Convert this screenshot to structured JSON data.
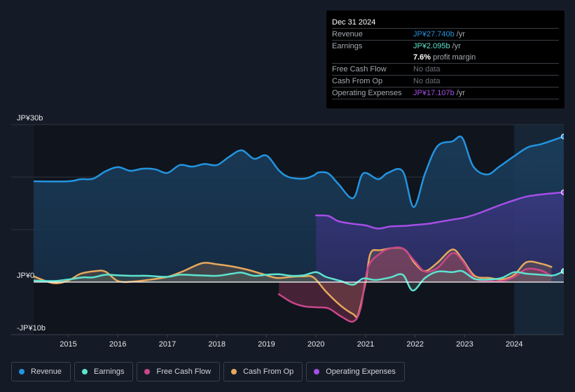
{
  "tooltip": {
    "date": "Dec 31 2024",
    "rows": [
      {
        "label": "Revenue",
        "value": "JP¥27.740b",
        "unit": " /yr",
        "color": "#2394df"
      },
      {
        "label": "Earnings",
        "value": "JP¥2.095b",
        "unit": " /yr",
        "color": "#5de3cf"
      },
      {
        "label": "",
        "value": "7.6%",
        "unit": " profit margin",
        "color": "#ffffff"
      },
      {
        "label": "Free Cash Flow",
        "value": "No data",
        "unit": "",
        "color": "#6b7078"
      },
      {
        "label": "Cash From Op",
        "value": "No data",
        "unit": "",
        "color": "#6b7078"
      },
      {
        "label": "Operating Expenses",
        "value": "JP¥17.107b",
        "unit": " /yr",
        "color": "#a64ee6"
      }
    ]
  },
  "legend": [
    {
      "label": "Revenue",
      "color": "#2394df"
    },
    {
      "label": "Earnings",
      "color": "#5de3cf"
    },
    {
      "label": "Free Cash Flow",
      "color": "#c8478a"
    },
    {
      "label": "Cash From Op",
      "color": "#e6a85d"
    },
    {
      "label": "Operating Expenses",
      "color": "#a64ee6"
    }
  ],
  "chart_data": {
    "type": "area",
    "title": "",
    "xlabel": "",
    "ylabel": "",
    "currency_unit": "JP¥ billions",
    "xlim": [
      2014.3,
      2025.0
    ],
    "ylim": [
      -10,
      30
    ],
    "y_ticks": [
      {
        "value": 30,
        "label": "JP¥30b"
      },
      {
        "value": 0,
        "label": "JP¥0"
      },
      {
        "value": -10,
        "label": "-JP¥10b"
      }
    ],
    "x_ticks": [
      {
        "value": 2015,
        "label": "2015"
      },
      {
        "value": 2016,
        "label": "2016"
      },
      {
        "value": 2017,
        "label": "2017"
      },
      {
        "value": 2018,
        "label": "2018"
      },
      {
        "value": 2019,
        "label": "2019"
      },
      {
        "value": 2020,
        "label": "2020"
      },
      {
        "value": 2021,
        "label": "2021"
      },
      {
        "value": 2022,
        "label": "2022"
      },
      {
        "value": 2023,
        "label": "2023"
      },
      {
        "value": 2024,
        "label": "2024"
      }
    ],
    "grid": true,
    "highlight_from": 2024.0,
    "legend_position": "bottom-left",
    "series": [
      {
        "name": "Revenue",
        "color": "#2394df",
        "points": [
          [
            2014.3,
            19.2
          ],
          [
            2015.0,
            19.2
          ],
          [
            2015.25,
            19.6
          ],
          [
            2015.5,
            19.7
          ],
          [
            2015.75,
            21.1
          ],
          [
            2016.0,
            21.9
          ],
          [
            2016.25,
            21.2
          ],
          [
            2016.5,
            21.6
          ],
          [
            2016.75,
            21.5
          ],
          [
            2017.0,
            20.8
          ],
          [
            2017.25,
            22.3
          ],
          [
            2017.5,
            22.0
          ],
          [
            2017.75,
            22.5
          ],
          [
            2018.0,
            22.3
          ],
          [
            2018.25,
            23.9
          ],
          [
            2018.5,
            25.1
          ],
          [
            2018.75,
            23.5
          ],
          [
            2019.0,
            24.1
          ],
          [
            2019.25,
            21.3
          ],
          [
            2019.45,
            20.0
          ],
          [
            2019.75,
            19.7
          ],
          [
            2019.95,
            20.3
          ],
          [
            2020.05,
            20.9
          ],
          [
            2020.25,
            20.7
          ],
          [
            2020.45,
            18.7
          ],
          [
            2020.75,
            16.0
          ],
          [
            2020.95,
            20.7
          ],
          [
            2021.25,
            19.6
          ],
          [
            2021.45,
            20.8
          ],
          [
            2021.75,
            21.1
          ],
          [
            2021.97,
            14.3
          ],
          [
            2022.2,
            20.7
          ],
          [
            2022.45,
            25.9
          ],
          [
            2022.75,
            26.8
          ],
          [
            2022.95,
            27.5
          ],
          [
            2023.17,
            22.1
          ],
          [
            2023.45,
            20.5
          ],
          [
            2023.7,
            22.0
          ],
          [
            2024.0,
            24.0
          ],
          [
            2024.28,
            25.7
          ],
          [
            2024.55,
            26.3
          ],
          [
            2025.0,
            27.74
          ]
        ]
      },
      {
        "name": "Earnings",
        "color": "#5de3cf",
        "points": [
          [
            2014.3,
            0.3
          ],
          [
            2014.7,
            0.2
          ],
          [
            2015.0,
            0.5
          ],
          [
            2015.3,
            0.9
          ],
          [
            2015.5,
            0.9
          ],
          [
            2015.75,
            1.4
          ],
          [
            2016.0,
            1.3
          ],
          [
            2016.3,
            1.2
          ],
          [
            2016.6,
            1.2
          ],
          [
            2017.0,
            1.0
          ],
          [
            2017.25,
            1.4
          ],
          [
            2017.6,
            1.3
          ],
          [
            2018.0,
            1.2
          ],
          [
            2018.3,
            1.6
          ],
          [
            2018.5,
            1.8
          ],
          [
            2018.75,
            1.2
          ],
          [
            2019.0,
            1.4
          ],
          [
            2019.25,
            1.5
          ],
          [
            2019.5,
            1.2
          ],
          [
            2019.75,
            1.3
          ],
          [
            2020.0,
            1.9
          ],
          [
            2020.2,
            1.0
          ],
          [
            2020.5,
            0.2
          ],
          [
            2020.75,
            -0.5
          ],
          [
            2020.95,
            0.7
          ],
          [
            2021.2,
            0.4
          ],
          [
            2021.5,
            0.9
          ],
          [
            2021.75,
            1.4
          ],
          [
            2021.95,
            -1.6
          ],
          [
            2022.2,
            0.8
          ],
          [
            2022.45,
            2.0
          ],
          [
            2022.75,
            1.9
          ],
          [
            2022.95,
            2.1
          ],
          [
            2023.2,
            0.6
          ],
          [
            2023.5,
            0.5
          ],
          [
            2023.75,
            0.8
          ],
          [
            2024.0,
            1.9
          ],
          [
            2024.25,
            1.6
          ],
          [
            2024.55,
            1.4
          ],
          [
            2024.8,
            1.3
          ],
          [
            2025.0,
            2.095
          ]
        ]
      },
      {
        "name": "Free Cash Flow",
        "color": "#c8478a",
        "points": [
          [
            2019.25,
            -2.3
          ],
          [
            2019.5,
            -3.8
          ],
          [
            2019.75,
            -4.6
          ],
          [
            2020.0,
            -4.8
          ],
          [
            2020.25,
            -5.0
          ],
          [
            2020.5,
            -6.5
          ],
          [
            2020.75,
            -7.5
          ],
          [
            2020.9,
            -5.0
          ],
          [
            2021.05,
            2.8
          ],
          [
            2021.3,
            5.5
          ],
          [
            2021.5,
            6.4
          ],
          [
            2021.75,
            6.4
          ],
          [
            2022.0,
            3.9
          ],
          [
            2022.2,
            2.0
          ],
          [
            2022.45,
            2.7
          ],
          [
            2022.75,
            5.5
          ],
          [
            2022.95,
            4.1
          ],
          [
            2023.2,
            0.7
          ],
          [
            2023.5,
            0.2
          ],
          [
            2023.75,
            0.2
          ],
          [
            2024.0,
            1.0
          ],
          [
            2024.25,
            2.5
          ],
          [
            2024.55,
            2.2
          ],
          [
            2024.75,
            1.1
          ]
        ]
      },
      {
        "name": "Cash From Op",
        "color": "#e6a85d",
        "points": [
          [
            2014.3,
            1.1
          ],
          [
            2014.7,
            -0.2
          ],
          [
            2015.0,
            0.3
          ],
          [
            2015.25,
            1.6
          ],
          [
            2015.55,
            2.1
          ],
          [
            2015.75,
            2.0
          ],
          [
            2016.0,
            0.2
          ],
          [
            2016.3,
            0.1
          ],
          [
            2016.6,
            0.4
          ],
          [
            2017.0,
            1.0
          ],
          [
            2017.3,
            2.0
          ],
          [
            2017.7,
            3.6
          ],
          [
            2018.0,
            3.4
          ],
          [
            2018.3,
            3.0
          ],
          [
            2018.6,
            2.4
          ],
          [
            2018.9,
            1.6
          ],
          [
            2019.2,
            0.8
          ],
          [
            2019.5,
            1.0
          ],
          [
            2019.75,
            1.1
          ],
          [
            2019.95,
            0.9
          ],
          [
            2020.2,
            -1.8
          ],
          [
            2020.5,
            -4.5
          ],
          [
            2020.75,
            -6.1
          ],
          [
            2020.85,
            -6.2
          ],
          [
            2021.0,
            0.0
          ],
          [
            2021.1,
            5.5
          ],
          [
            2021.3,
            6.1
          ],
          [
            2021.75,
            6.4
          ],
          [
            2022.0,
            3.5
          ],
          [
            2022.2,
            2.1
          ],
          [
            2022.45,
            3.7
          ],
          [
            2022.75,
            6.2
          ],
          [
            2022.95,
            4.4
          ],
          [
            2023.2,
            1.2
          ],
          [
            2023.5,
            0.8
          ],
          [
            2023.75,
            0.5
          ],
          [
            2024.0,
            1.4
          ],
          [
            2024.25,
            3.8
          ],
          [
            2024.55,
            3.5
          ],
          [
            2024.75,
            2.9
          ]
        ]
      },
      {
        "name": "Operating Expenses",
        "color": "#a64ee6",
        "points": [
          [
            2020.0,
            12.7
          ],
          [
            2020.25,
            12.6
          ],
          [
            2020.45,
            11.6
          ],
          [
            2020.75,
            11.1
          ],
          [
            2021.0,
            10.8
          ],
          [
            2021.25,
            10.2
          ],
          [
            2021.5,
            10.6
          ],
          [
            2021.75,
            10.7
          ],
          [
            2022.0,
            10.9
          ],
          [
            2022.25,
            11.1
          ],
          [
            2022.5,
            11.5
          ],
          [
            2022.75,
            11.9
          ],
          [
            2023.0,
            12.3
          ],
          [
            2023.25,
            13.0
          ],
          [
            2023.5,
            13.9
          ],
          [
            2023.75,
            14.8
          ],
          [
            2024.0,
            15.6
          ],
          [
            2024.25,
            16.3
          ],
          [
            2024.55,
            16.7
          ],
          [
            2025.0,
            17.107
          ]
        ]
      }
    ]
  }
}
